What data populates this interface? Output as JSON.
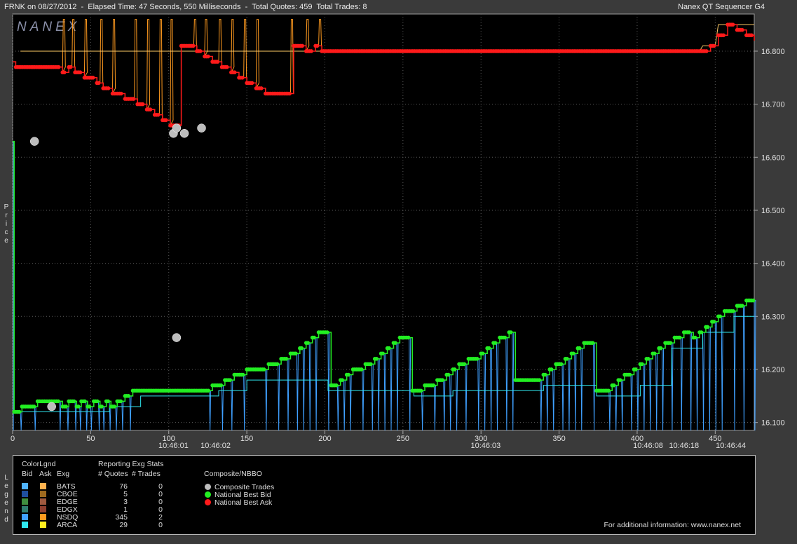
{
  "header": {
    "left": "FRNK on 08/27/2012  -  Elapsed Time: 47 Seconds, 550 Milliseconds  -  Total Quotes: 459  Total Trades: 8",
    "right": "Nanex QT Sequencer G4",
    "logo": "NANEX"
  },
  "yaxis_label": [
    "P",
    "r",
    "i",
    "c",
    "e"
  ],
  "legend_side_label": [
    "L",
    "e",
    "g",
    "e",
    "n",
    "d"
  ],
  "legend": {
    "color_title": "ColorLgnd",
    "col_bid": "Bid",
    "col_ask": "Ask",
    "col_exg": "Exg",
    "stats_title": "Reporting Exg Stats",
    "col_quotes": "# Quotes",
    "col_trades": "# Trades",
    "rows": [
      {
        "exg": "BATS",
        "quotes": "76",
        "trades": "0",
        "bid_color": "#4fb3ff",
        "ask_color": "#ffb24f"
      },
      {
        "exg": "CBOE",
        "quotes": "5",
        "trades": "0",
        "bid_color": "#1f4f9f",
        "ask_color": "#9f6a1f"
      },
      {
        "exg": "EDGE",
        "quotes": "3",
        "trades": "0",
        "bid_color": "#3f8f3f",
        "ask_color": "#a05a3f"
      },
      {
        "exg": "EDGX",
        "quotes": "1",
        "trades": "0",
        "bid_color": "#2f7f6f",
        "ask_color": "#8f3f2f"
      },
      {
        "exg": "NSDQ",
        "quotes": "345",
        "trades": "2",
        "bid_color": "#3fa0ff",
        "ask_color": "#ff9a1f"
      },
      {
        "exg": "ARCA",
        "quotes": "29",
        "trades": "0",
        "bid_color": "#2fe8f0",
        "ask_color": "#ffee1f"
      }
    ],
    "composite_title": "Composite/NBBO",
    "composite_items": [
      {
        "label": "Composite Trades",
        "color": "#bdbdbd"
      },
      {
        "label": "National Best Bid",
        "color": "#22ee22"
      },
      {
        "label": "National Best Ask",
        "color": "#ff1a1a"
      }
    ],
    "footer": "For additional information: www.nanex.net"
  },
  "chart_data": {
    "type": "line",
    "xlim": [
      0,
      475
    ],
    "ylim": [
      16.085,
      16.87
    ],
    "x_ticks": [
      0,
      50,
      100,
      150,
      200,
      250,
      300,
      350,
      400,
      450
    ],
    "y_ticks": [
      16.1,
      16.2,
      16.3,
      16.4,
      16.5,
      16.6,
      16.7,
      16.8
    ],
    "y_tick_labels": [
      "16.100",
      "16.200",
      "16.300",
      "16.400",
      "16.500",
      "16.600",
      "16.700",
      "16.800"
    ],
    "time_labels": [
      {
        "x": 103,
        "label": "10:46:01"
      },
      {
        "x": 130,
        "label": "10:46:02"
      },
      {
        "x": 303,
        "label": "10:46:03"
      },
      {
        "x": 407,
        "label": "10:46:08"
      },
      {
        "x": 430,
        "label": "10:46:18"
      },
      {
        "x": 460,
        "label": "10:46:44"
      }
    ],
    "grid": true,
    "colors": {
      "bid": "#22ee22",
      "ask": "#ff1a1a",
      "trade": "#bdbdbd",
      "ask_exg": "#ff9a1f",
      "bid_exg": "#3fa0ff",
      "bid_exg2": "#2fe8f0",
      "ask_exg2": "#ffcc66"
    },
    "series": [
      {
        "name": "National Best Ask",
        "points": [
          [
            0,
            16.78
          ],
          [
            2,
            16.77
          ],
          [
            30,
            16.77
          ],
          [
            32,
            16.76
          ],
          [
            34,
            16.76
          ],
          [
            36,
            16.77
          ],
          [
            38,
            16.77
          ],
          [
            40,
            16.76
          ],
          [
            44,
            16.76
          ],
          [
            46,
            16.75
          ],
          [
            52,
            16.75
          ],
          [
            54,
            16.74
          ],
          [
            56,
            16.74
          ],
          [
            58,
            16.73
          ],
          [
            62,
            16.73
          ],
          [
            64,
            16.72
          ],
          [
            70,
            16.72
          ],
          [
            72,
            16.71
          ],
          [
            78,
            16.71
          ],
          [
            80,
            16.7
          ],
          [
            84,
            16.7
          ],
          [
            86,
            16.69
          ],
          [
            89,
            16.69
          ],
          [
            91,
            16.68
          ],
          [
            94,
            16.68
          ],
          [
            96,
            16.67
          ],
          [
            99,
            16.67
          ],
          [
            101,
            16.66
          ],
          [
            107,
            16.66
          ],
          [
            108,
            16.81
          ],
          [
            116,
            16.81
          ],
          [
            118,
            16.8
          ],
          [
            121,
            16.8
          ],
          [
            123,
            16.79
          ],
          [
            126,
            16.79
          ],
          [
            128,
            16.78
          ],
          [
            132,
            16.78
          ],
          [
            134,
            16.77
          ],
          [
            138,
            16.77
          ],
          [
            140,
            16.76
          ],
          [
            143,
            16.76
          ],
          [
            145,
            16.75
          ],
          [
            148,
            16.75
          ],
          [
            150,
            16.74
          ],
          [
            154,
            16.74
          ],
          [
            156,
            16.73
          ],
          [
            160,
            16.73
          ],
          [
            162,
            16.72
          ],
          [
            178,
            16.72
          ],
          [
            180,
            16.81
          ],
          [
            186,
            16.81
          ],
          [
            188,
            16.8
          ],
          [
            192,
            16.8
          ],
          [
            194,
            16.81
          ],
          [
            196,
            16.81
          ],
          [
            198,
            16.8
          ],
          [
            445,
            16.8
          ],
          [
            447,
            16.81
          ],
          [
            450,
            16.81
          ],
          [
            452,
            16.83
          ],
          [
            456,
            16.83
          ],
          [
            458,
            16.85
          ],
          [
            462,
            16.85
          ],
          [
            464,
            16.84
          ],
          [
            468,
            16.84
          ],
          [
            470,
            16.83
          ],
          [
            474,
            16.83
          ],
          [
            475,
            16.82
          ]
        ]
      },
      {
        "name": "National Best Bid",
        "points": [
          [
            0,
            16.63
          ],
          [
            1,
            16.12
          ],
          [
            5,
            16.12
          ],
          [
            6,
            16.13
          ],
          [
            14,
            16.13
          ],
          [
            16,
            16.14
          ],
          [
            30,
            16.14
          ],
          [
            32,
            16.13
          ],
          [
            35,
            16.13
          ],
          [
            36,
            16.14
          ],
          [
            40,
            16.14
          ],
          [
            41,
            16.13
          ],
          [
            43,
            16.13
          ],
          [
            44,
            16.14
          ],
          [
            47,
            16.14
          ],
          [
            48,
            16.13
          ],
          [
            50,
            16.13
          ],
          [
            52,
            16.14
          ],
          [
            55,
            16.14
          ],
          [
            56,
            16.13
          ],
          [
            58,
            16.13
          ],
          [
            60,
            16.14
          ],
          [
            62,
            16.14
          ],
          [
            63,
            16.13
          ],
          [
            66,
            16.13
          ],
          [
            67,
            16.14
          ],
          [
            70,
            16.14
          ],
          [
            72,
            16.15
          ],
          [
            75,
            16.15
          ],
          [
            77,
            16.16
          ],
          [
            126,
            16.16
          ],
          [
            128,
            16.17
          ],
          [
            134,
            16.17
          ],
          [
            136,
            16.18
          ],
          [
            140,
            16.18
          ],
          [
            142,
            16.19
          ],
          [
            148,
            16.19
          ],
          [
            150,
            16.2
          ],
          [
            162,
            16.2
          ],
          [
            164,
            16.21
          ],
          [
            170,
            16.21
          ],
          [
            172,
            16.22
          ],
          [
            176,
            16.22
          ],
          [
            178,
            16.23
          ],
          [
            182,
            16.23
          ],
          [
            184,
            16.24
          ],
          [
            186,
            16.24
          ],
          [
            188,
            16.25
          ],
          [
            190,
            16.25
          ],
          [
            192,
            16.26
          ],
          [
            194,
            16.26
          ],
          [
            196,
            16.27
          ],
          [
            202,
            16.27
          ],
          [
            204,
            16.17
          ],
          [
            208,
            16.17
          ],
          [
            210,
            16.18
          ],
          [
            212,
            16.18
          ],
          [
            214,
            16.19
          ],
          [
            216,
            16.19
          ],
          [
            218,
            16.2
          ],
          [
            224,
            16.2
          ],
          [
            226,
            16.21
          ],
          [
            230,
            16.21
          ],
          [
            232,
            16.22
          ],
          [
            234,
            16.22
          ],
          [
            236,
            16.23
          ],
          [
            238,
            16.23
          ],
          [
            240,
            16.24
          ],
          [
            242,
            16.24
          ],
          [
            244,
            16.25
          ],
          [
            246,
            16.25
          ],
          [
            248,
            16.26
          ],
          [
            254,
            16.26
          ],
          [
            256,
            16.16
          ],
          [
            262,
            16.16
          ],
          [
            264,
            16.17
          ],
          [
            270,
            16.17
          ],
          [
            272,
            16.18
          ],
          [
            276,
            16.18
          ],
          [
            278,
            16.19
          ],
          [
            280,
            16.19
          ],
          [
            282,
            16.2
          ],
          [
            284,
            16.2
          ],
          [
            286,
            16.21
          ],
          [
            290,
            16.21
          ],
          [
            292,
            16.22
          ],
          [
            298,
            16.22
          ],
          [
            300,
            16.23
          ],
          [
            302,
            16.23
          ],
          [
            304,
            16.24
          ],
          [
            306,
            16.24
          ],
          [
            308,
            16.25
          ],
          [
            310,
            16.25
          ],
          [
            312,
            16.26
          ],
          [
            316,
            16.26
          ],
          [
            318,
            16.27
          ],
          [
            320,
            16.27
          ],
          [
            322,
            16.18
          ],
          [
            338,
            16.18
          ],
          [
            340,
            16.19
          ],
          [
            342,
            16.19
          ],
          [
            344,
            16.2
          ],
          [
            346,
            16.2
          ],
          [
            348,
            16.21
          ],
          [
            352,
            16.21
          ],
          [
            354,
            16.22
          ],
          [
            356,
            16.22
          ],
          [
            358,
            16.23
          ],
          [
            360,
            16.23
          ],
          [
            362,
            16.24
          ],
          [
            364,
            16.24
          ],
          [
            366,
            16.25
          ],
          [
            372,
            16.25
          ],
          [
            374,
            16.16
          ],
          [
            382,
            16.16
          ],
          [
            384,
            16.17
          ],
          [
            386,
            16.17
          ],
          [
            388,
            16.18
          ],
          [
            390,
            16.18
          ],
          [
            392,
            16.19
          ],
          [
            396,
            16.19
          ],
          [
            398,
            16.2
          ],
          [
            400,
            16.2
          ],
          [
            402,
            16.21
          ],
          [
            404,
            16.21
          ],
          [
            406,
            16.22
          ],
          [
            408,
            16.22
          ],
          [
            410,
            16.23
          ],
          [
            412,
            16.23
          ],
          [
            414,
            16.24
          ],
          [
            416,
            16.24
          ],
          [
            418,
            16.25
          ],
          [
            422,
            16.25
          ],
          [
            424,
            16.26
          ],
          [
            428,
            16.26
          ],
          [
            430,
            16.27
          ],
          [
            434,
            16.27
          ],
          [
            436,
            16.26
          ],
          [
            438,
            16.26
          ],
          [
            440,
            16.27
          ],
          [
            442,
            16.27
          ],
          [
            444,
            16.28
          ],
          [
            446,
            16.28
          ],
          [
            448,
            16.29
          ],
          [
            450,
            16.29
          ],
          [
            452,
            16.3
          ],
          [
            454,
            16.3
          ],
          [
            456,
            16.31
          ],
          [
            462,
            16.31
          ],
          [
            464,
            16.32
          ],
          [
            468,
            16.32
          ],
          [
            470,
            16.33
          ],
          [
            475,
            16.33
          ]
        ]
      },
      {
        "name": "Composite Trades",
        "points": [
          [
            14,
            16.63
          ],
          [
            25,
            16.13
          ],
          [
            103,
            16.645
          ],
          [
            105,
            16.655
          ],
          [
            110,
            16.645
          ],
          [
            105,
            16.26
          ],
          [
            121,
            16.655
          ]
        ]
      }
    ]
  }
}
